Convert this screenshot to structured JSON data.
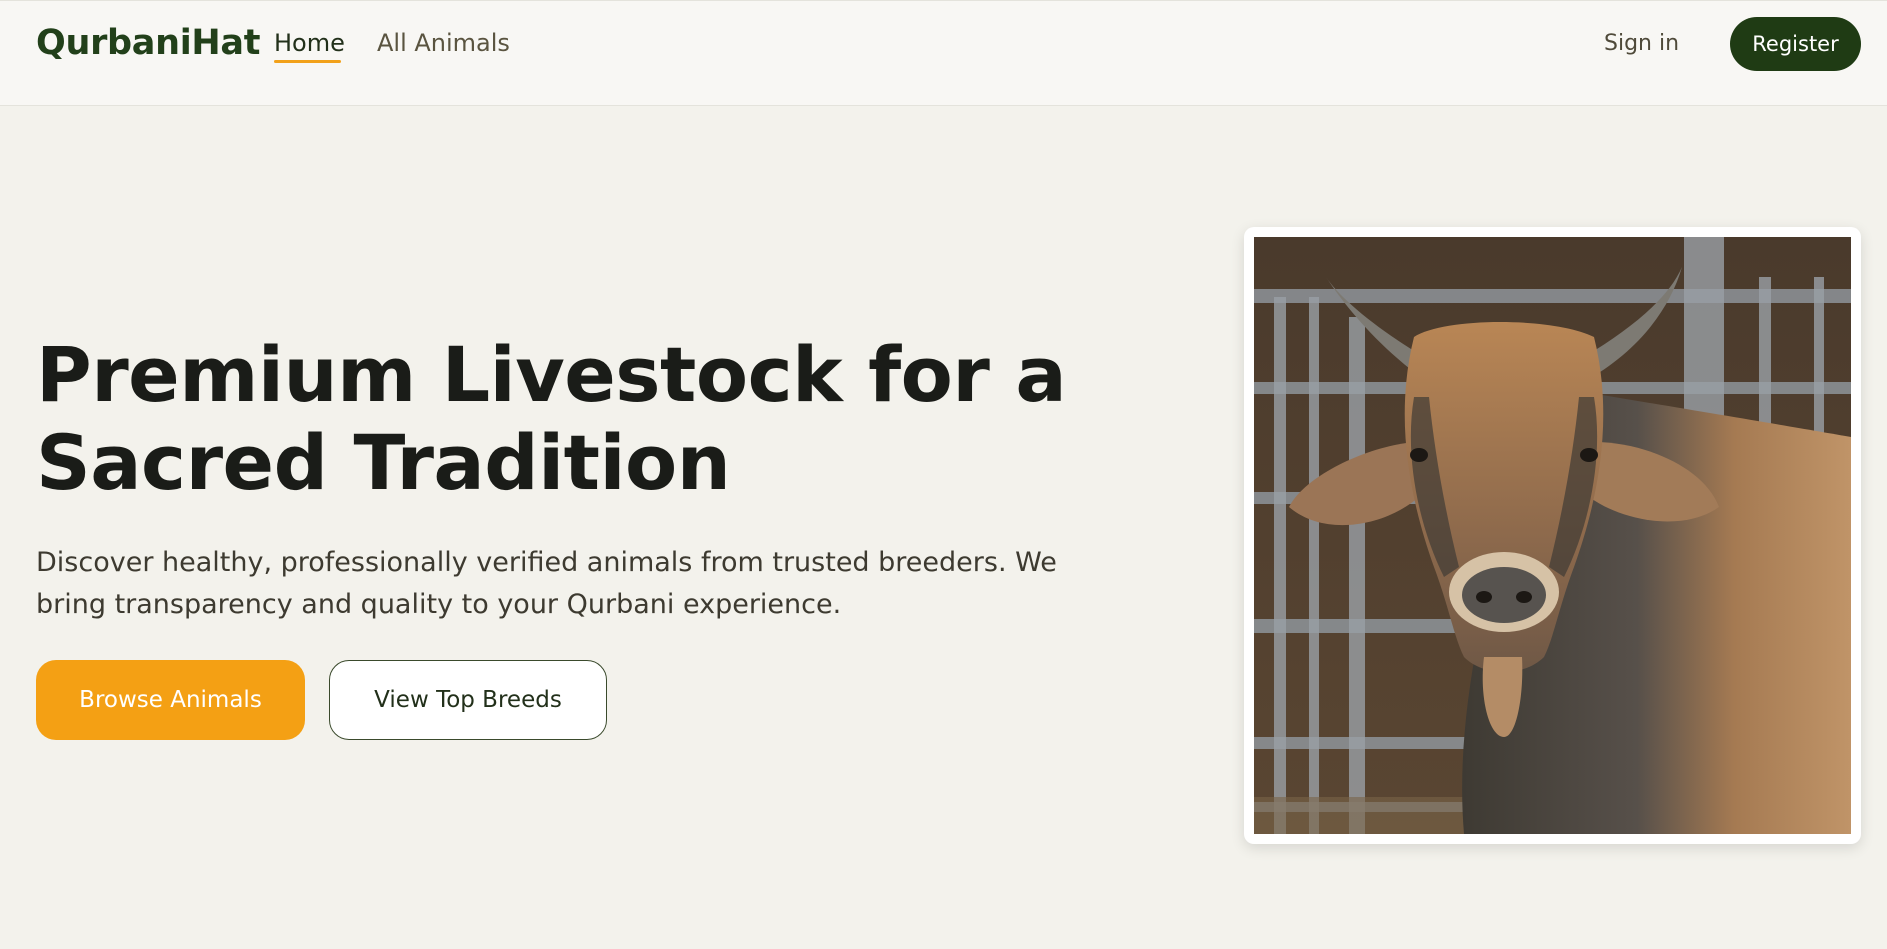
{
  "nav": {
    "brand": "QurbaniHat",
    "links": [
      {
        "label": "Home",
        "active": true
      },
      {
        "label": "All Animals",
        "active": false
      }
    ],
    "signin_label": "Sign in",
    "register_label": "Register"
  },
  "hero": {
    "title": "Premium Livestock for a Sacred Tradition",
    "subtitle": "Discover healthy, professionally verified animals from trusted breeders. We bring transparency and quality to your Qurbani experience.",
    "primary_button": "Browse Animals",
    "secondary_button": "View Top Breeds"
  },
  "colors": {
    "brand_green": "#1f3b14",
    "accent_orange": "#f4a014",
    "page_bg": "#f3f2ec"
  }
}
